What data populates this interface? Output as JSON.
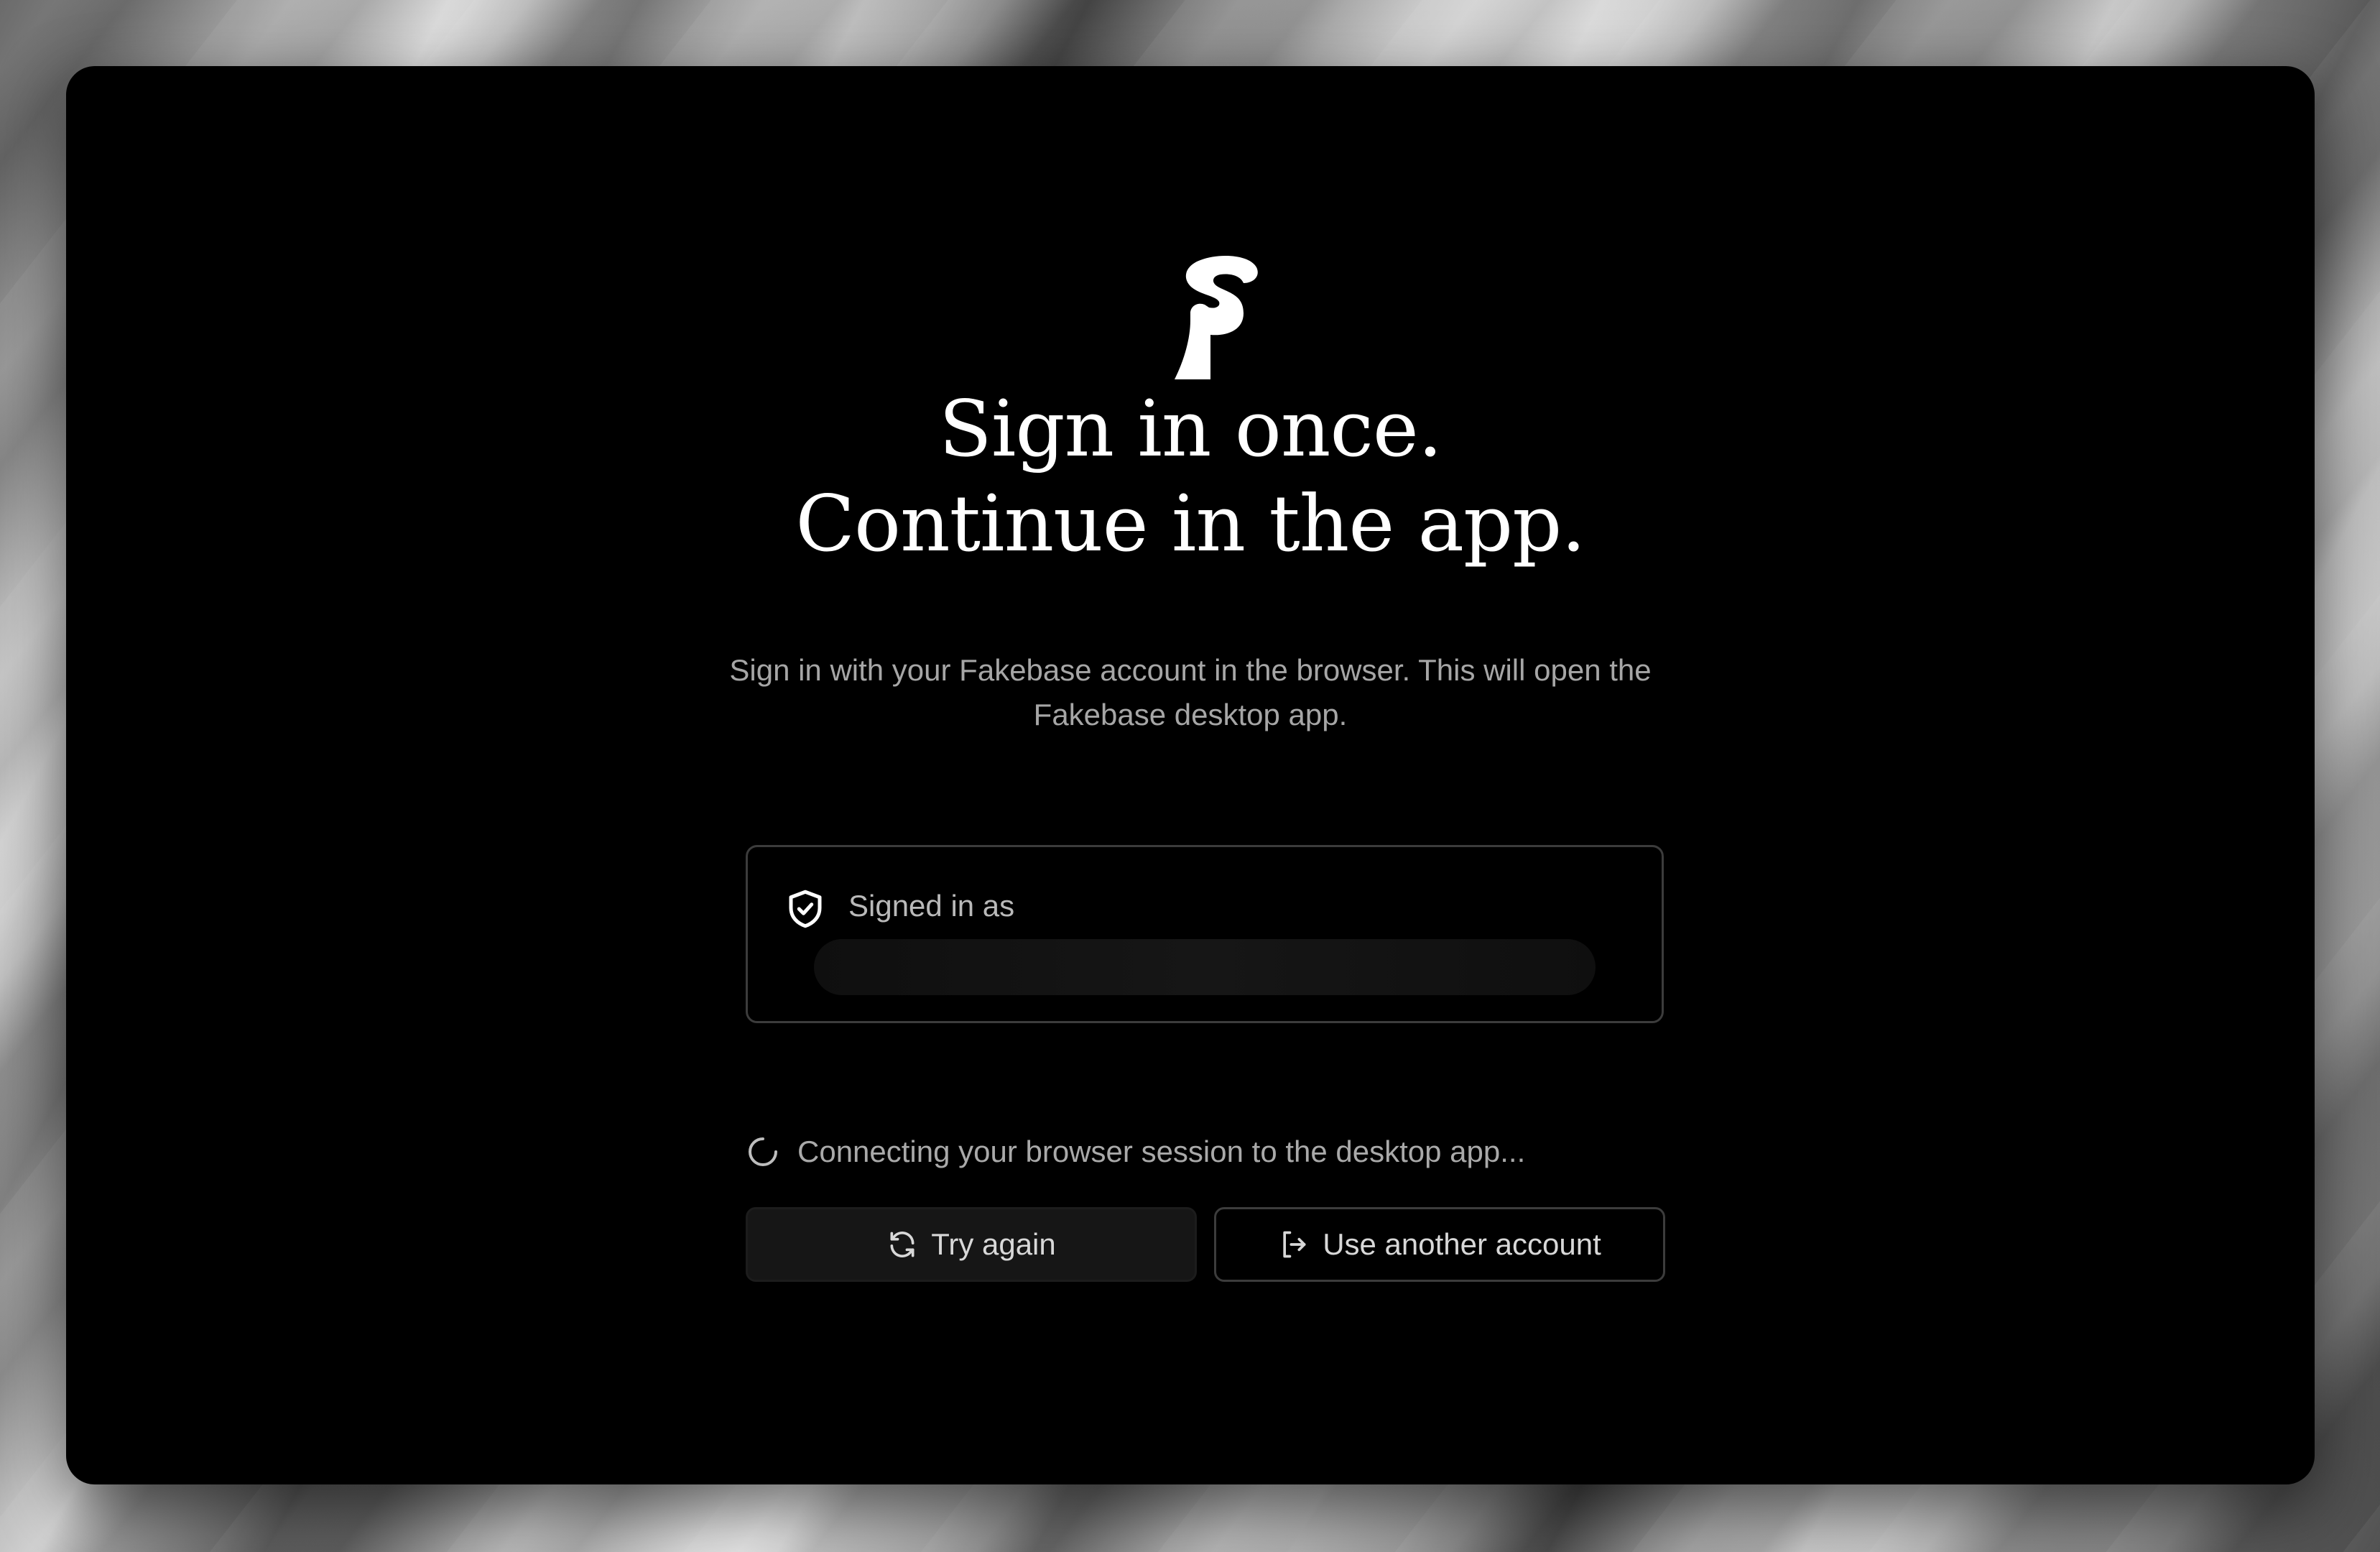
{
  "background": {
    "window_color": "#000000"
  },
  "brand": {
    "logo_icon": "fakebase-logo-icon"
  },
  "headline": {
    "line1": "Sign in once.",
    "line2": "Continue in the app."
  },
  "subtitle": "Sign in with your Fakebase account in the browser. This will open the Fakebase desktop app.",
  "account_card": {
    "icon": "shield-check-icon",
    "label": "Signed in as"
  },
  "status": {
    "icon": "spinner-icon",
    "text": "Connecting your browser session to the desktop app..."
  },
  "actions": {
    "try_again": {
      "icon": "refresh-icon",
      "label": "Try again"
    },
    "use_another": {
      "icon": "log-out-icon",
      "label": "Use another account"
    }
  }
}
